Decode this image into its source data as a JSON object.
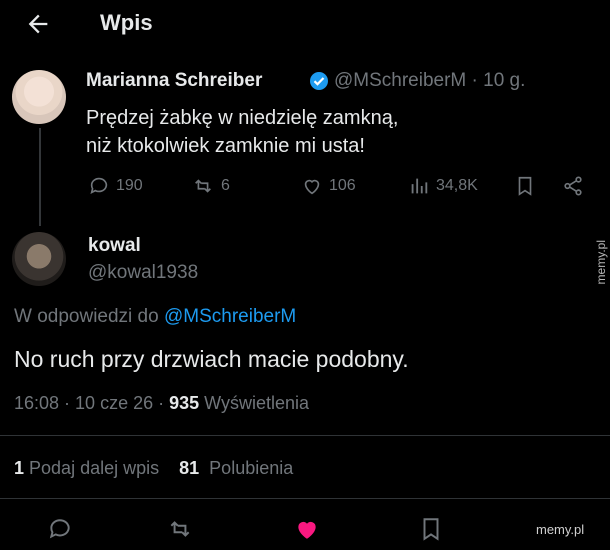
{
  "header": {
    "title": "Wpis"
  },
  "post": {
    "author": "Marianna Schreiber",
    "handle_time": "@MSchreiberM · 10 g.",
    "text_lines": [
      "Prędzej żabkę w niedzielę zamkną,",
      "niż ktokolwiek zamknie mi usta!"
    ],
    "stats": {
      "replies": "190",
      "reposts": "6",
      "likes": "106",
      "views": "34,8K"
    }
  },
  "reply": {
    "name": "kowal",
    "handle": "@kowal1938",
    "reply_to_prefix": "W odpowiedzi do",
    "reply_to_link": "@MSchreiberM",
    "text": "No ruch przy drzwiach macie podobny.",
    "timestamp": "16:08 · 10 cze 26 · ",
    "views_count": "935",
    "views_label": "Wyświetlenia"
  },
  "engagement": {
    "reposts_count": "1",
    "reposts_label": "Podaj dalej wpis",
    "likes_count": "81",
    "likes_label": "Polubienia"
  },
  "watermark": "memy.pl",
  "colors": {
    "background": "#000000",
    "text": "#e7e9ea",
    "muted": "#71767b",
    "link": "#1d9bf0",
    "like": "#f91880",
    "verified": "#1d9bf0"
  }
}
